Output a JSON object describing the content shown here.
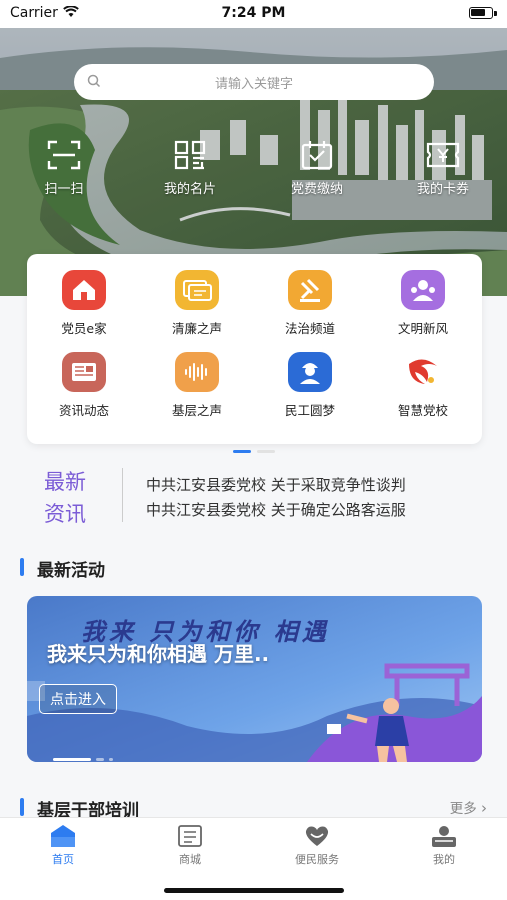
{
  "status_bar": {
    "carrier": "Carrier",
    "time": "7:24 PM"
  },
  "search": {
    "placeholder": "请输入关键字"
  },
  "quick_actions": [
    {
      "label": "扫一扫",
      "icon": "scan-icon"
    },
    {
      "label": "我的名片",
      "icon": "qr-card-icon"
    },
    {
      "label": "党费缴纳",
      "icon": "payment-icon"
    },
    {
      "label": "我的卡券",
      "icon": "coupon-icon"
    }
  ],
  "menu": [
    {
      "label": "党员e家",
      "icon": "home-icon",
      "color": "#e8473a"
    },
    {
      "label": "清廉之声",
      "icon": "message-icon",
      "color": "#f2b632"
    },
    {
      "label": "法治频道",
      "icon": "gavel-icon",
      "color": "#f2a833"
    },
    {
      "label": "文明新风",
      "icon": "people-icon",
      "color": "#a56ee0"
    },
    {
      "label": "资讯动态",
      "icon": "newspaper-icon",
      "color": "#c8665a"
    },
    {
      "label": "基层之声",
      "icon": "audio-wave-icon",
      "color": "#f0a04a"
    },
    {
      "label": "民工圆梦",
      "icon": "worker-icon",
      "color": "#2b6bd6"
    },
    {
      "label": "智慧党校",
      "icon": "party-emblem-icon",
      "color": "#e03a2f"
    }
  ],
  "news": {
    "title": "最新资讯",
    "items": [
      "中共江安县委党校 关于采取竞争性谈判",
      "中共江安县委党校 关于确定公路客运服"
    ]
  },
  "activities": {
    "title": "最新活动",
    "banner_art_text": "我来 只为和你 相遇",
    "banner_title": "我来只为和你相遇 万里..",
    "banner_button": "点击进入"
  },
  "training": {
    "title": "基层干部培训",
    "more": "更多"
  },
  "tabs": [
    {
      "label": "首页",
      "icon": "home-tab-icon",
      "active": true
    },
    {
      "label": "商城",
      "icon": "mall-icon",
      "active": false
    },
    {
      "label": "便民服务",
      "icon": "heart-service-icon",
      "active": false
    },
    {
      "label": "我的",
      "icon": "profile-icon",
      "active": false
    }
  ],
  "colors": {
    "accent": "#2d7cf0",
    "news_title": "#7b5cd6",
    "tab_inactive": "#777777"
  }
}
